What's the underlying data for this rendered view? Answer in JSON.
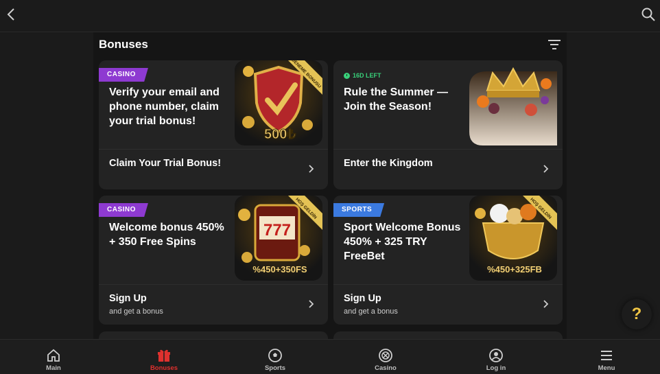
{
  "header": {
    "back_icon": "chevron-left-icon",
    "search_icon": "search-icon"
  },
  "section": {
    "title": "Bonuses",
    "filter_icon": "filter-icon"
  },
  "cards": [
    {
      "badge": "CASINO",
      "title": "Verify your email and phone number, claim your trial bonus!",
      "art_ribbon": "DENEME BONUSU",
      "art_amount": "500₺",
      "cta": "Claim Your Trial Bonus!",
      "cta_sub": ""
    },
    {
      "timer": "16D LEFT",
      "title": "Rule the Summer — Join the Season!",
      "cta": "Enter the Kingdom",
      "cta_sub": ""
    },
    {
      "badge": "CASINO",
      "title": "Welcome bonus 450% + 350 Free Spins",
      "art_ribbon": "HOŞ GELDİN",
      "art_amount": "%450+350FS",
      "art_reels": "777",
      "cta": "Sign Up",
      "cta_sub": "and get a bonus"
    },
    {
      "badge": "SPORTS",
      "title": "Sport Welcome Bonus 450% + 325 TRY FreeBet",
      "art_ribbon": "HOŞ GELDİN",
      "art_amount": "%450+325FB",
      "cta": "Sign Up",
      "cta_sub": "and get a bonus"
    }
  ],
  "help": {
    "label": "?"
  },
  "nav": [
    {
      "label": "Main",
      "icon": "home-icon",
      "active": false
    },
    {
      "label": "Bonuses",
      "icon": "gift-icon",
      "active": true
    },
    {
      "label": "Sports",
      "icon": "soccer-ball-icon",
      "active": false
    },
    {
      "label": "Casino",
      "icon": "casino-chip-icon",
      "active": false
    },
    {
      "label": "Log in",
      "icon": "user-icon",
      "active": false
    },
    {
      "label": "Menu",
      "icon": "hamburger-menu-icon",
      "active": false
    }
  ],
  "colors": {
    "accent": "#e0312e",
    "casino_badge": "#8e3ad1",
    "sports_badge": "#3b7ae0",
    "timer": "#39d07a",
    "gold": "#d9a93a"
  }
}
